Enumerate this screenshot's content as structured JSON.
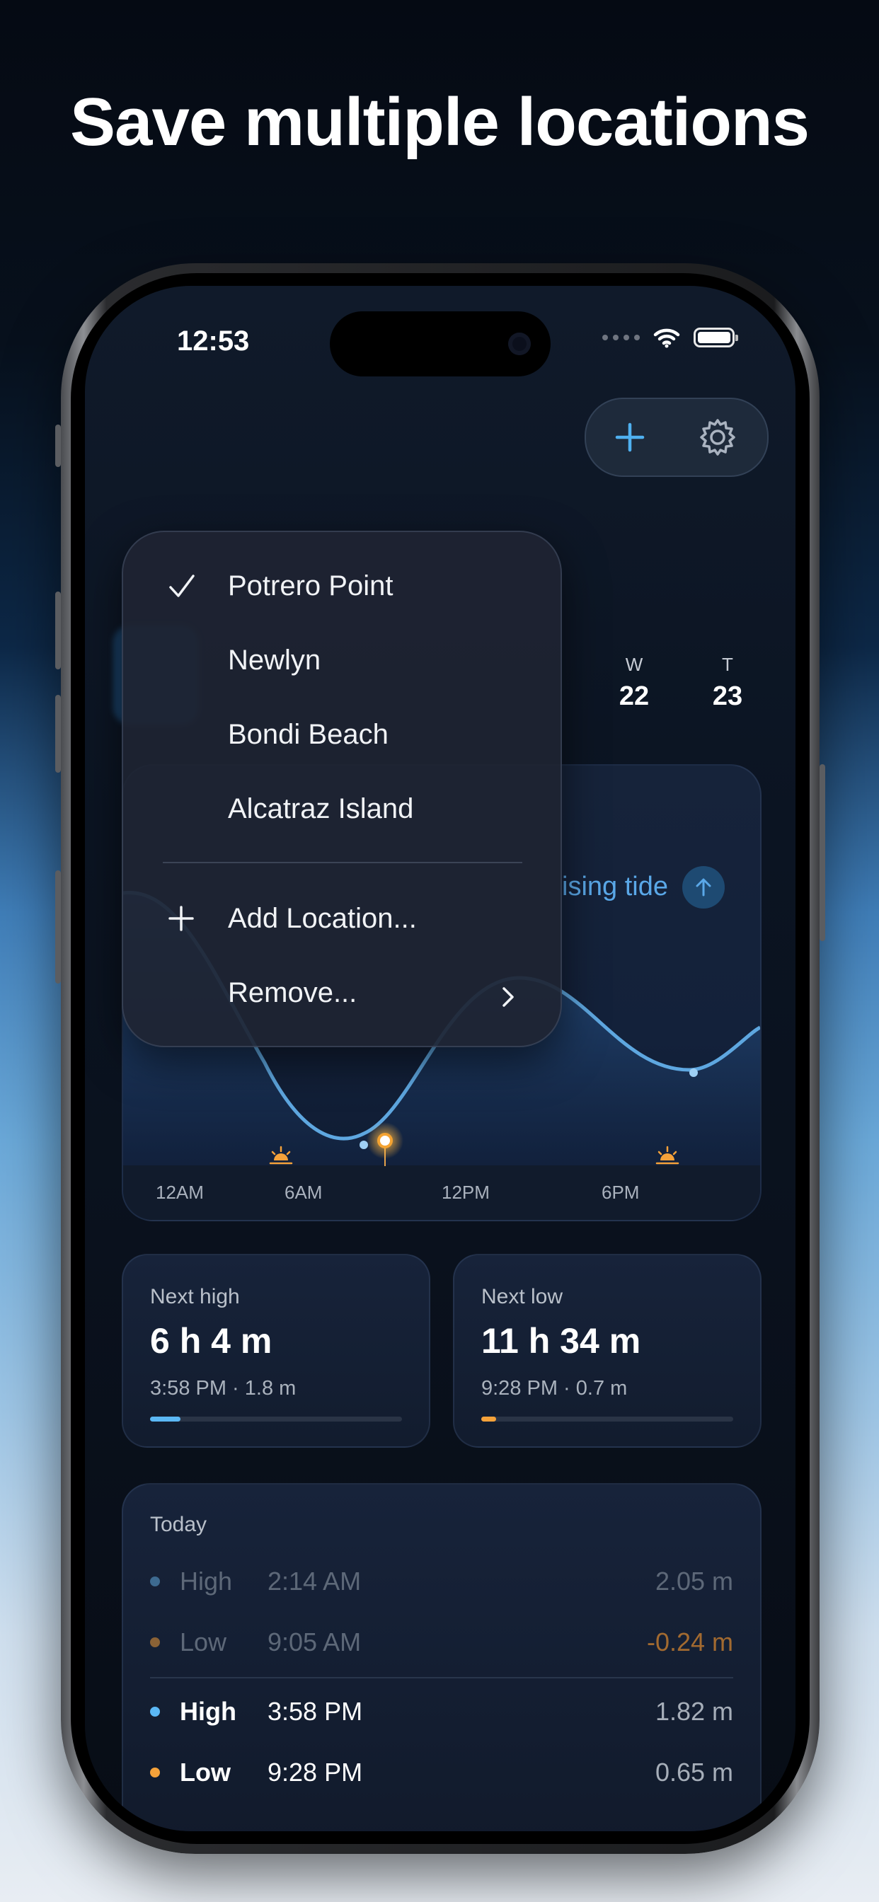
{
  "headline": "Save multiple locations",
  "status": {
    "time": "12:53"
  },
  "days": [
    {
      "letter": "W",
      "number": "22"
    },
    {
      "letter": "T",
      "number": "23"
    }
  ],
  "chart": {
    "state_label": "ising tide",
    "x_ticks": [
      "12AM",
      "6AM",
      "12PM",
      "6PM"
    ]
  },
  "cards": {
    "next_high": {
      "label": "Next high",
      "value": "6 h 4 m",
      "detail": "3:58 PM · 1.8 m",
      "progress": 0.12,
      "color": "#5bb8f5"
    },
    "next_low": {
      "label": "Next low",
      "value": "11 h 34 m",
      "detail": "9:28 PM · 0.7 m",
      "progress": 0.06,
      "color": "#f5a23a"
    }
  },
  "today": {
    "title": "Today",
    "rows": [
      {
        "type": "High",
        "time": "2:14 AM",
        "height": "2.05 m",
        "past": true
      },
      {
        "type": "Low",
        "time": "9:05 AM",
        "height": "-0.24 m",
        "past": true
      },
      {
        "type": "High",
        "time": "3:58 PM",
        "height": "1.82 m",
        "past": false
      },
      {
        "type": "Low",
        "time": "9:28 PM",
        "height": "0.65 m",
        "past": false
      }
    ]
  },
  "menu": {
    "locations": [
      "Potrero Point",
      "Newlyn",
      "Bondi Beach",
      "Alcatraz Island"
    ],
    "selected_index": 0,
    "add_label": "Add Location...",
    "remove_label": "Remove..."
  },
  "colors": {
    "accent_blue": "#5bb8f5",
    "accent_orange": "#f5a23a"
  }
}
